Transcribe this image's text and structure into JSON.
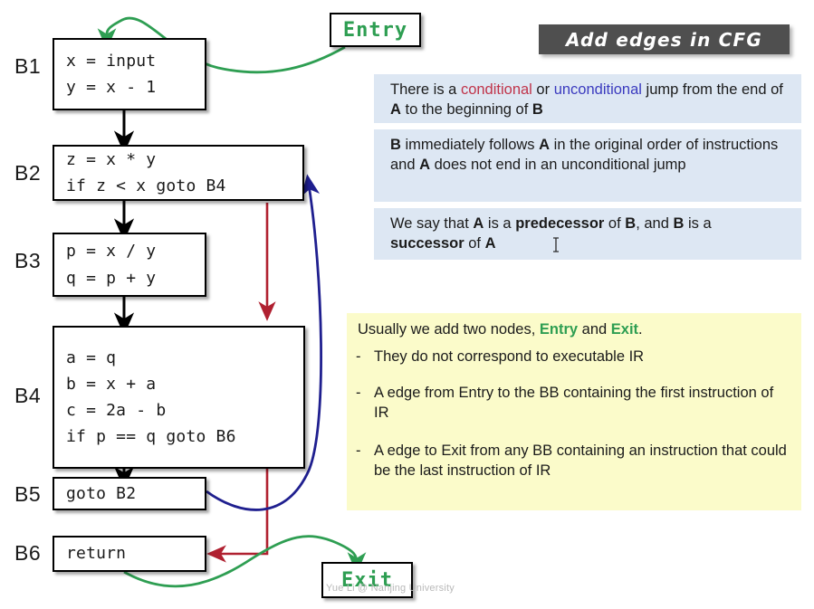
{
  "diagram": {
    "entry_label": "Entry",
    "exit_label": "Exit",
    "watermark": "Yue Li @ Nanjing University",
    "blocks": [
      {
        "id": "B1",
        "label": "B1",
        "code": "x = input\ny = x - 1"
      },
      {
        "id": "B2",
        "label": "B2",
        "code": "z = x * y\nif z < x goto B4"
      },
      {
        "id": "B3",
        "label": "B3",
        "code": "p = x / y\nq = p + y"
      },
      {
        "id": "B4",
        "label": "B4",
        "code": "a = q\nb = x + a\nc = 2a - b\nif p == q goto B6"
      },
      {
        "id": "B5",
        "label": "B5",
        "code": "goto B2"
      },
      {
        "id": "B6",
        "label": "B6",
        "code": "return"
      }
    ],
    "edge_colors": {
      "fallthrough": "#000000",
      "conditional": "#b02030",
      "unconditional": "#1f1f8f",
      "entry_exit": "#2e9e52"
    }
  },
  "panel": {
    "title": "Add edges in CFG",
    "title_bg": "#4f4f4f",
    "info_boxes": [
      {
        "id": "rule-jump",
        "parts": [
          {
            "text": "There is a ",
            "style": "plain"
          },
          {
            "text": "conditional",
            "style": "conditional"
          },
          {
            "text": " or ",
            "style": "plain"
          },
          {
            "text": "unconditional",
            "style": "unconditional"
          },
          {
            "text": " jump from the end of ",
            "style": "plain"
          },
          {
            "text": "A",
            "style": "bold"
          },
          {
            "text": " to the beginning of ",
            "style": "plain"
          },
          {
            "text": "B",
            "style": "bold"
          }
        ]
      },
      {
        "id": "rule-fallthrough",
        "parts": [
          {
            "text": "B",
            "style": "bold"
          },
          {
            "text": " immediately follows ",
            "style": "plain"
          },
          {
            "text": "A",
            "style": "bold"
          },
          {
            "text": " in the original order of instructions and ",
            "style": "plain"
          },
          {
            "text": "A",
            "style": "bold"
          },
          {
            "text": " does not end in an unconditional jump",
            "style": "plain"
          }
        ]
      },
      {
        "id": "rule-pred-succ",
        "parts": [
          {
            "text": "We say that ",
            "style": "plain"
          },
          {
            "text": "A",
            "style": "bold"
          },
          {
            "text": " is a ",
            "style": "plain"
          },
          {
            "text": "predecessor",
            "style": "bold"
          },
          {
            "text": " of ",
            "style": "plain"
          },
          {
            "text": "B",
            "style": "bold"
          },
          {
            "text": ", and ",
            "style": "plain"
          },
          {
            "text": "B",
            "style": "bold"
          },
          {
            "text": " is a ",
            "style": "plain"
          },
          {
            "text": "successor",
            "style": "bold"
          },
          {
            "text": " of ",
            "style": "plain"
          },
          {
            "text": "A",
            "style": "bold"
          }
        ]
      }
    ],
    "note": {
      "bg": "#fbfbca",
      "heading_parts": [
        {
          "text": "Usually we add two nodes, ",
          "style": "plain"
        },
        {
          "text": "Entry",
          "style": "green"
        },
        {
          "text": " and ",
          "style": "plain"
        },
        {
          "text": "Exit",
          "style": "green"
        },
        {
          "text": ".",
          "style": "plain"
        }
      ],
      "bullet_marker": "-",
      "bullets": [
        "They do not correspond to executable IR",
        "A edge from Entry to the BB containing the first instruction of IR",
        "A edge to Exit from any BB containing an instruction that could be the last instruction of IR"
      ]
    }
  }
}
